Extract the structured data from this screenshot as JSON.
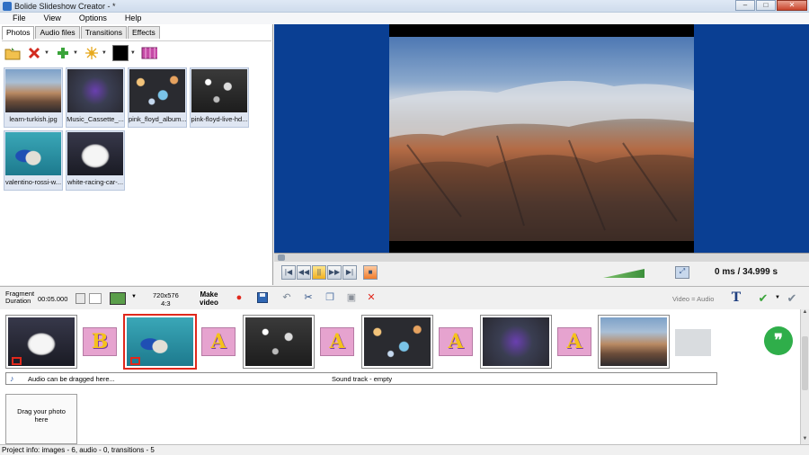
{
  "window": {
    "title": "Bolide Slideshow Creator - *",
    "minimize": "–",
    "maximize": "□",
    "close": "✕"
  },
  "menu": [
    "File",
    "View",
    "Options",
    "Help"
  ],
  "tabs": [
    "Photos",
    "Audio files",
    "Transitions",
    "Effects"
  ],
  "photos_toolbar": {
    "icons": [
      "open-folder-icon",
      "delete-icon",
      "add-icon",
      "effects-icon",
      "color-swatch",
      "slideshow-icon"
    ],
    "background_color": "#000000"
  },
  "photos": [
    {
      "caption": "learn-turkish.jpg",
      "texture": "mountain"
    },
    {
      "caption": "Music_Cassette_...",
      "texture": "cassette"
    },
    {
      "caption": "pink_floyd_album...",
      "texture": "bokeh"
    },
    {
      "caption": "pink-floyd-live-hd...",
      "texture": "bw"
    },
    {
      "caption": "valentino-rossi-w...",
      "texture": "moto"
    },
    {
      "caption": "white-racing-car-...",
      "texture": "car"
    }
  ],
  "preview": {
    "background": "#0a3f93",
    "time_current": "0 ms",
    "time_total": "/ 34.999 s"
  },
  "transport": {
    "first": "|◀",
    "prev": "◀◀",
    "play": "||",
    "next": "▶▶",
    "last": "▶|",
    "stop": "■",
    "fullscreen": "⤢"
  },
  "storyboard_toolbar": {
    "fragment_label_line1": "Fragment",
    "fragment_label_line2": "Duration",
    "fragment_duration": "00:05.000",
    "resolution_line1": "720x576",
    "resolution_line2": "4:3",
    "make_video_line1": "Make",
    "make_video_line2": "video",
    "video_audio": "Video = Audio",
    "text_tool": "T"
  },
  "timeline": {
    "slides": [
      {
        "texture": "car",
        "badge": true,
        "selected": false
      },
      {
        "texture": "moto",
        "badge": true,
        "selected": true
      },
      {
        "texture": "bw",
        "badge": false,
        "selected": false
      },
      {
        "texture": "bokeh",
        "badge": false,
        "selected": false
      },
      {
        "texture": "cassette",
        "badge": false,
        "selected": false
      },
      {
        "texture": "mountain",
        "badge": false,
        "selected": false
      }
    ],
    "transitions": [
      "B",
      "A",
      "A",
      "A",
      "A"
    ],
    "audio_hint": "Audio can be dragged here...",
    "soundtrack": "Sound track - empty",
    "drop_line1": "Drag your photo",
    "drop_line2": "here",
    "action_button": "❞"
  },
  "status": {
    "project_info": "Project info: images - 6, audio - 0, transitions - 5"
  },
  "colors": {
    "accent_red": "#e0281c",
    "action_green": "#2fae4a",
    "preview_blue": "#0a3f93"
  }
}
